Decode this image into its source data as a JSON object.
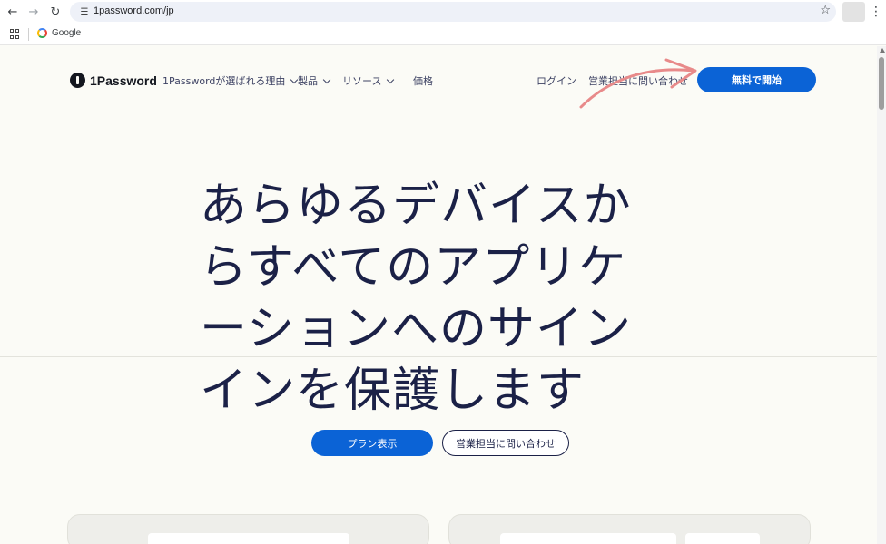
{
  "browser": {
    "url": "1password.com/jp",
    "bookmark_google": "Google"
  },
  "header": {
    "logo_text": "1Password",
    "nav": [
      {
        "label": "1Passwordが選ばれる理由"
      },
      {
        "label": "製品"
      },
      {
        "label": "リソース"
      },
      {
        "label": "価格"
      }
    ],
    "login": "ログイン",
    "contact_sales": "営業担当に問い合わせ",
    "cta": "無料で開始"
  },
  "hero": {
    "lines": [
      "あらゆるデバイスか",
      "らすべてのアプリケ",
      "ーションへのサイン",
      "インを保護します"
    ],
    "primary_button": "プラン表示",
    "secondary_button": "営業担当に問い合わせ"
  },
  "colors": {
    "accent": "#0b63d6",
    "text": "#1b2147",
    "background": "#fbfbf6",
    "annotation_arrow": "#e88a8a"
  }
}
